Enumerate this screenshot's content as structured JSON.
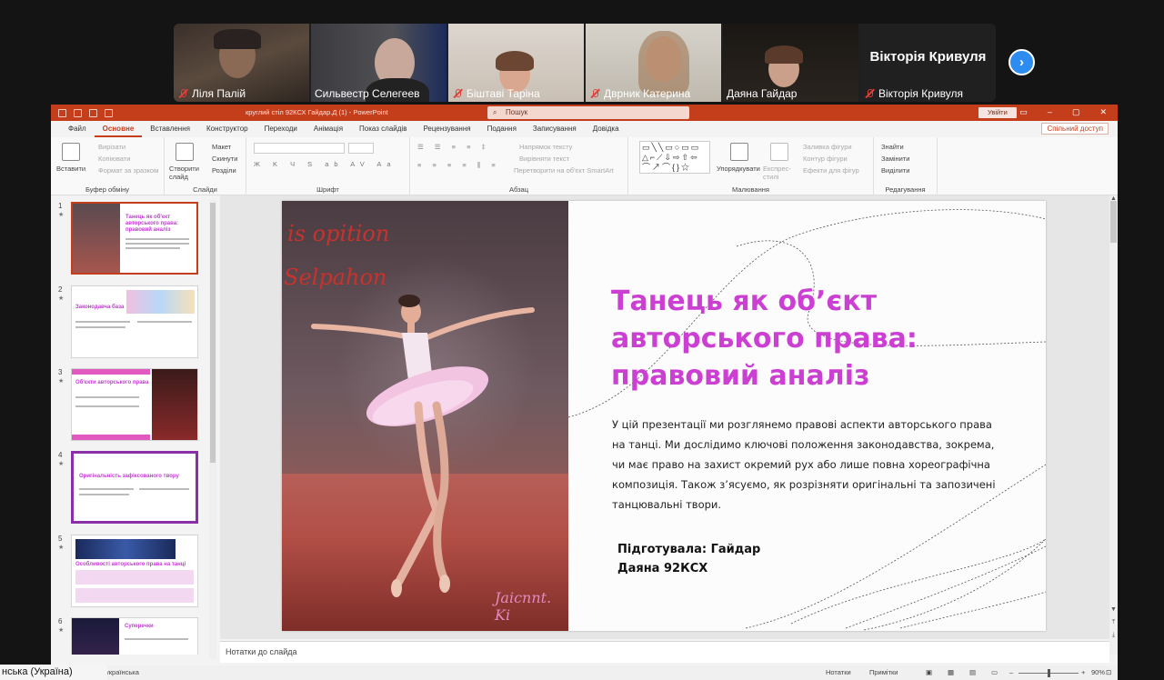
{
  "participants": [
    {
      "name": "Ліля Палій",
      "muted": true
    },
    {
      "name": "Сильвестр Селегеев",
      "muted": false
    },
    {
      "name": "Біштаві Таріна",
      "muted": true
    },
    {
      "name": "Дврник Катерина",
      "muted": true
    },
    {
      "name": "Даяна Гайдар",
      "muted": false,
      "active": true
    },
    {
      "name": "Вікторія Кривуля",
      "muted": true,
      "display_name": "Вікторія Кривуля"
    }
  ],
  "next_icon": "chevron-right-icon",
  "ppt": {
    "doc_title": "круглий стіл 92КСХ Гайдар.Д (1)  -  PowerPoint",
    "search_placeholder": "Пошук",
    "signin": "Увійти",
    "share": "Спільний доступ",
    "tabs": [
      "Файл",
      "Основне",
      "Вставлення",
      "Конструктор",
      "Переходи",
      "Анімація",
      "Показ слайдів",
      "Рецензування",
      "Подання",
      "Записування",
      "Довідка"
    ],
    "ribbon": {
      "paste": "Вставити",
      "cut": "Вирізати",
      "copy": "Копіювати",
      "format_painter": "Формат за зразком",
      "clipboard_group": "Буфер обміну",
      "new_slide": "Створити слайд",
      "layout": "Макет",
      "reset": "Скинути",
      "sections": "Розділи",
      "slides_group": "Слайди",
      "font_group": "Шрифт",
      "text_direction": "Напрямок тексту",
      "align_text": "Вирівняти текст",
      "convert_smartart": "Перетворити на об'єкт SmartArt",
      "paragraph_group": "Абзац",
      "arrange": "Упорядкувати",
      "quick_styles": "Експрес-стилі",
      "shape_fill": "Заливка фігури",
      "shape_outline": "Контур фігури",
      "shape_effects": "Ефекти для фігур",
      "drawing_group": "Малювання",
      "find": "Знайти",
      "replace": "Замінити",
      "select": "Виділити",
      "editing_group": "Редагування"
    },
    "thumbnails": [
      {
        "num": "1",
        "title": "Танець як об'єкт авторського права: правовий аналіз"
      },
      {
        "num": "2",
        "title": "Законодавча база"
      },
      {
        "num": "3",
        "title": "Об'єкти авторського права"
      },
      {
        "num": "4",
        "title": "Оригінальність зафіксованого твору"
      },
      {
        "num": "5",
        "title": "Особливості авторського права на танці"
      },
      {
        "num": "6",
        "title": "Суперечки"
      }
    ],
    "slide": {
      "script_top": "is opition",
      "script_mid": "Selpahon",
      "script_bottom": "Jaicnnt. Ki",
      "title": "Танець як об’єкт авторського права: правовий аналіз",
      "body": "У цій презентації ми розглянемо правові аспекти авторського права на танці. Ми дослідимо ключові положення законодавства, зокрема, чи має право на захист окремий рух або лише повна хореографічна композиція. Також з’ясуємо, як розрізняти оригінальні та запозичені танцювальні твори.",
      "author": "Підготувала: Гайдар Даяна 92КСХ"
    },
    "notes_placeholder": "Нотатки до слайда",
    "status": {
      "language": "українська",
      "notes": "Нотатки",
      "comments": "Примітки",
      "zoom": "90%"
    }
  },
  "lang_toast": "нська (Україна)",
  "colors": {
    "accent": "#c43e1c",
    "title_pink": "#cc3fd3",
    "active_tile": "#2ecc71"
  }
}
